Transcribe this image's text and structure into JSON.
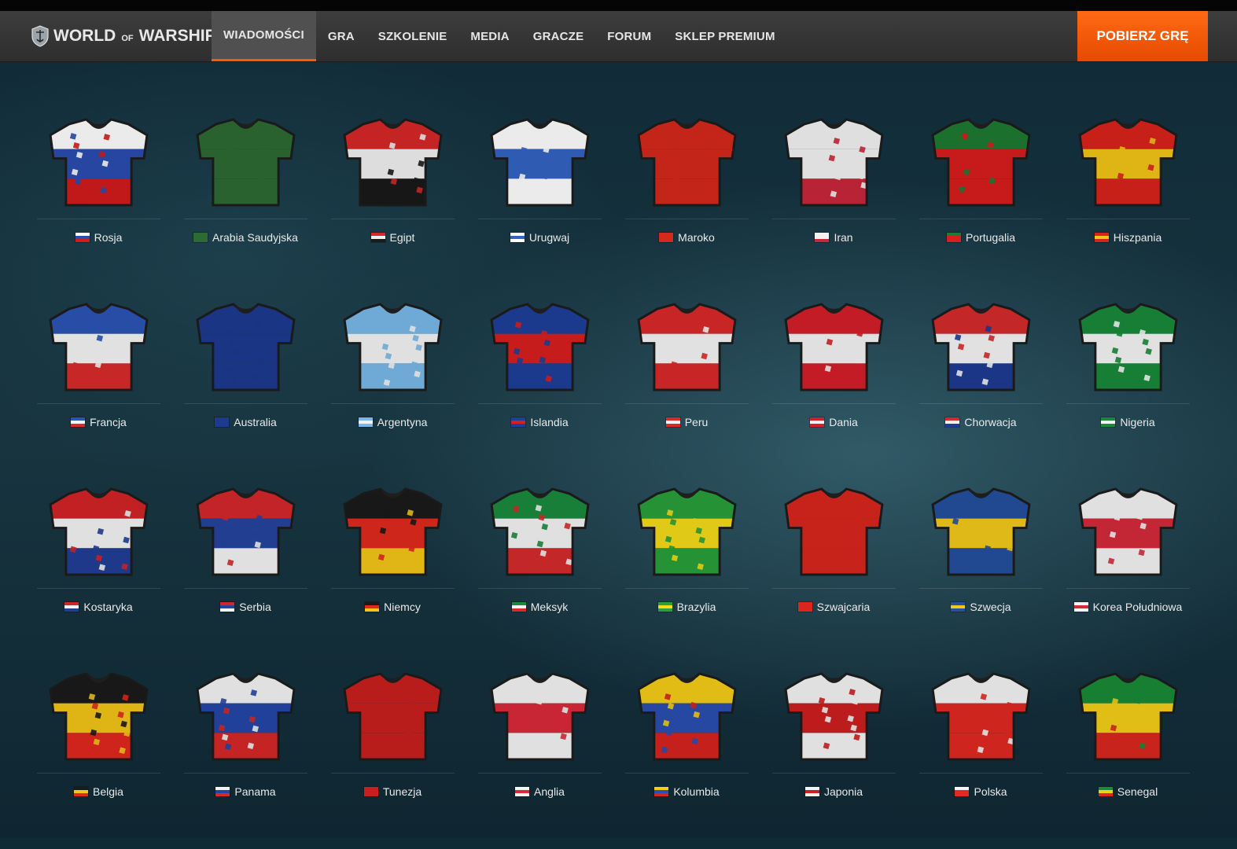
{
  "brand": {
    "logo_text_main1": "WORLD",
    "logo_text_of": "OF",
    "logo_text_main2": "WARSHIPS"
  },
  "nav": {
    "items": [
      {
        "label": "WIADOMOŚCI",
        "active": true
      },
      {
        "label": "GRA"
      },
      {
        "label": "SZKOLENIE"
      },
      {
        "label": "MEDIA"
      },
      {
        "label": "GRACZE"
      },
      {
        "label": "FORUM"
      },
      {
        "label": "SKLEP PREMIUM"
      }
    ],
    "cta_label": "POBIERZ GRĘ",
    "accent": "#ff5a00"
  },
  "teams": [
    {
      "name": "Rosja",
      "colors": [
        "#ffffff",
        "#2a4db0",
        "#d21c1c"
      ]
    },
    {
      "name": "Arabia Saudyjska",
      "colors": [
        "#2d6a34",
        "#2d6a34",
        "#2d6a34"
      ]
    },
    {
      "name": "Egipt",
      "colors": [
        "#d62828",
        "#f0f0f0",
        "#1a1a1a"
      ]
    },
    {
      "name": "Urugwaj",
      "colors": [
        "#ffffff",
        "#3563c2",
        "#ffffff"
      ]
    },
    {
      "name": "Maroko",
      "colors": [
        "#d4291c",
        "#d4291c",
        "#d4291c"
      ]
    },
    {
      "name": "Iran",
      "colors": [
        "#f2f2f2",
        "#f2f2f2",
        "#c8283a"
      ]
    },
    {
      "name": "Portugalia",
      "colors": [
        "#1f7a32",
        "#d81e1e",
        "#d81e1e"
      ]
    },
    {
      "name": "Hiszpania",
      "colors": [
        "#d8231c",
        "#f2c417",
        "#d8231c"
      ]
    },
    {
      "name": "Francja",
      "colors": [
        "#2b54b5",
        "#f5f5f5",
        "#d92b2b"
      ]
    },
    {
      "name": "Australia",
      "colors": [
        "#1d3a8f",
        "#1d3a8f",
        "#1d3a8f"
      ]
    },
    {
      "name": "Argentyna",
      "colors": [
        "#79b8e8",
        "#f3f3f3",
        "#79b8e8"
      ]
    },
    {
      "name": "Islandia",
      "colors": [
        "#1f3f9a",
        "#d81f1f",
        "#1f3f9a"
      ]
    },
    {
      "name": "Peru",
      "colors": [
        "#d92a2a",
        "#f5f5f5",
        "#d92a2a"
      ]
    },
    {
      "name": "Dania",
      "colors": [
        "#d51f2a",
        "#f3f3f3",
        "#d51f2a"
      ]
    },
    {
      "name": "Chorwacja",
      "colors": [
        "#d52b2b",
        "#f5f5f5",
        "#1f3b93"
      ]
    },
    {
      "name": "Nigeria",
      "colors": [
        "#188a3a",
        "#f5f5f5",
        "#188a3a"
      ]
    },
    {
      "name": "Kostaryka",
      "colors": [
        "#d32428",
        "#f3f3f3",
        "#213e96"
      ]
    },
    {
      "name": "Serbia",
      "colors": [
        "#d3282b",
        "#25449e",
        "#f3f3f3"
      ]
    },
    {
      "name": "Niemcy",
      "colors": [
        "#1b1b1b",
        "#e02a1d",
        "#f3c518"
      ]
    },
    {
      "name": "Meksyk",
      "colors": [
        "#1b8a3e",
        "#f3f3f3",
        "#d52b2b"
      ]
    },
    {
      "name": "Brazylia",
      "colors": [
        "#29a03a",
        "#f5dc1a",
        "#29a03a"
      ]
    },
    {
      "name": "Szwajcaria",
      "colors": [
        "#d9261e",
        "#d9261e",
        "#d9261e"
      ]
    },
    {
      "name": "Szwecja",
      "colors": [
        "#24509e",
        "#f2c919",
        "#24509e"
      ]
    },
    {
      "name": "Korea Południowa",
      "colors": [
        "#f4f4f4",
        "#d42a3a",
        "#f4f4f4"
      ]
    },
    {
      "name": "Belgia",
      "colors": [
        "#1b1b1b",
        "#f2c517",
        "#e0281e"
      ]
    },
    {
      "name": "Panama",
      "colors": [
        "#f3f3f3",
        "#2346a6",
        "#d62828"
      ]
    },
    {
      "name": "Tunezja",
      "colors": [
        "#c8201f",
        "#c8201f",
        "#c8201f"
      ]
    },
    {
      "name": "Anglia",
      "colors": [
        "#f4f4f4",
        "#d92a3a",
        "#f4f4f4"
      ]
    },
    {
      "name": "Kolumbia",
      "colors": [
        "#f5cc17",
        "#2a4fb0",
        "#d6231e"
      ]
    },
    {
      "name": "Japonia",
      "colors": [
        "#f4f4f4",
        "#cc1f1f",
        "#f4f4f4"
      ]
    },
    {
      "name": "Polska",
      "colors": [
        "#f4f4f4",
        "#e02a22",
        "#e02a22"
      ]
    },
    {
      "name": "Senegal",
      "colors": [
        "#1a8a36",
        "#f3cf18",
        "#d9281f"
      ]
    }
  ]
}
